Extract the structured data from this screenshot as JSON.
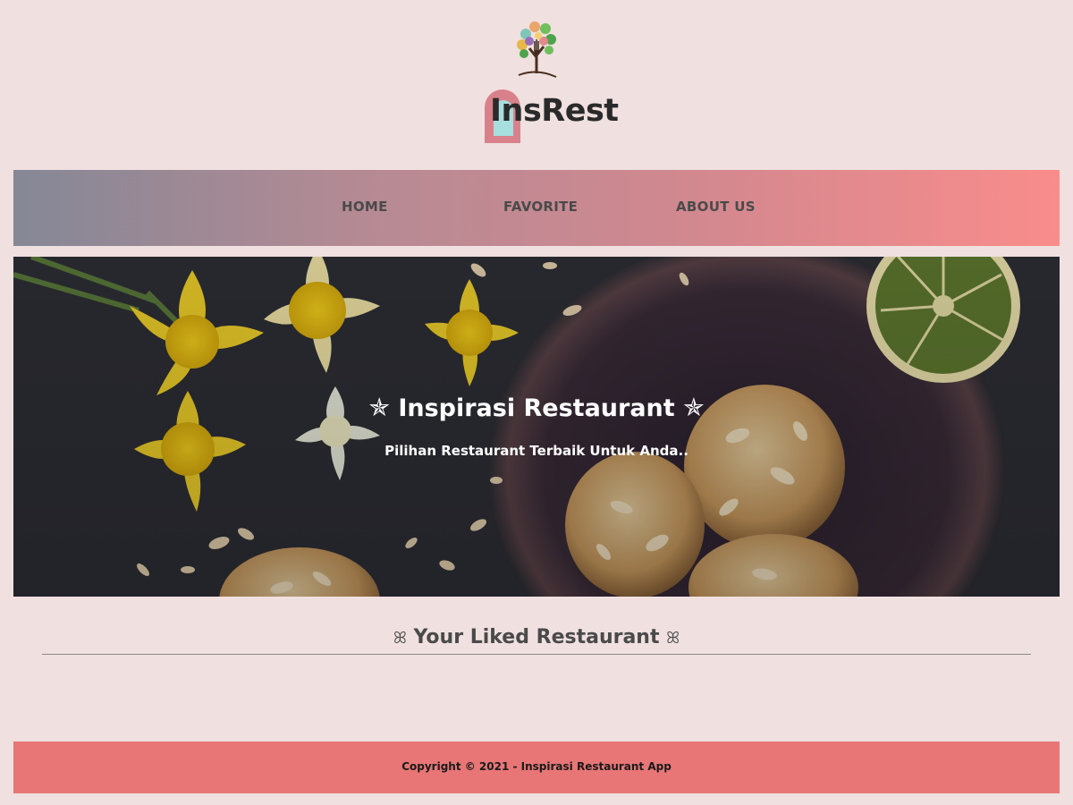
{
  "brand": {
    "name": "InsRest"
  },
  "nav": {
    "items": [
      {
        "label": "HOME"
      },
      {
        "label": "FAVORITE"
      },
      {
        "label": "ABOUT US"
      }
    ]
  },
  "hero": {
    "title": "Inspirasi Restaurant",
    "star_left": "✯",
    "star_right": "✯",
    "subtitle": "Pilihan Restaurant Terbaik Untuk Anda.."
  },
  "section": {
    "title": "Your Liked Restaurant",
    "ornament_left": "ꕤ",
    "ornament_right": "ꕤ"
  },
  "footer": {
    "text": "Copyright © 2021 - Inspirasi Restaurant App"
  },
  "colors": {
    "background": "#f0e0e0",
    "footer": "#e87676",
    "nav_start": "#858896",
    "nav_end": "#f98c8c",
    "text": "#4a4a4a"
  }
}
